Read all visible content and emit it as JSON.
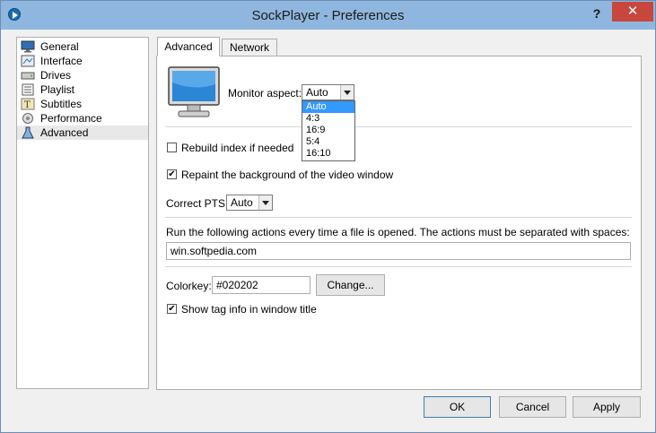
{
  "window": {
    "title": "SockPlayer - Preferences",
    "help_glyph": "?",
    "close_glyph": "✕"
  },
  "categories": [
    {
      "label": "General",
      "icon": "monitor-icon"
    },
    {
      "label": "Interface",
      "icon": "interface-icon"
    },
    {
      "label": "Drives",
      "icon": "drive-icon"
    },
    {
      "label": "Playlist",
      "icon": "playlist-icon"
    },
    {
      "label": "Subtitles",
      "icon": "subtitles-icon"
    },
    {
      "label": "Performance",
      "icon": "performance-icon"
    },
    {
      "label": "Advanced",
      "icon": "advanced-flask-icon",
      "selected": true
    }
  ],
  "tabs": [
    {
      "label": "Advanced",
      "active": true
    },
    {
      "label": "Network",
      "active": false
    }
  ],
  "advanced": {
    "monitor_aspect_label": "Monitor aspect:",
    "monitor_aspect_value": "Auto",
    "monitor_aspect_options": [
      "Auto",
      "4:3",
      "16:9",
      "5:4",
      "16:10"
    ],
    "rebuild_index": {
      "label": "Rebuild index if needed",
      "checked": false
    },
    "repaint_background": {
      "label": "Repaint the background of the video window",
      "checked": true
    },
    "correct_pts_label": "Correct PTS:",
    "correct_pts_value": "Auto",
    "actions_label": "Run the following actions every time a file is opened. The actions must be separated with spaces:",
    "actions_value": "win.softpedia.com",
    "colorkey_label": "Colorkey:",
    "colorkey_value": "#020202",
    "change_button": "Change...",
    "show_tag_info": {
      "label": "Show tag info in window title",
      "checked": true
    }
  },
  "footer": {
    "ok": "OK",
    "cancel": "Cancel",
    "apply": "Apply"
  },
  "check_glyph": "✔",
  "colors": {
    "titlebar": "#8fb6de",
    "close": "#c7473c",
    "selection": "#3399ff"
  }
}
